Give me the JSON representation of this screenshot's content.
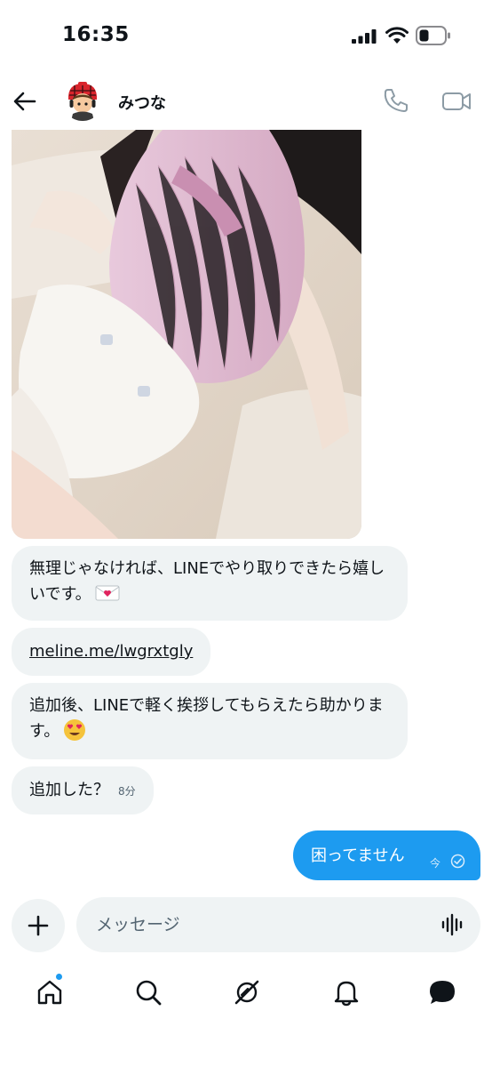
{
  "status_bar": {
    "time": "16:35"
  },
  "header": {
    "contact_name": "みつな"
  },
  "messages": {
    "m1": "無理じゃなければ、LINEでやり取りできたら嬉しいです。",
    "m2_link": "meline.me/lwgrxtgly",
    "m3": "追加後、LINEで軽く挨拶してもらえたら助かります。",
    "m4": "追加した？",
    "m4_time": "8分",
    "out": "困ってません",
    "out_time": "今"
  },
  "compose": {
    "placeholder": "メッセージ"
  },
  "colors": {
    "accent": "#1d9bf0",
    "bubble_in": "#eff3f4",
    "text": "#0f1419",
    "muted": "#536471"
  },
  "icons": [
    "back-arrow-icon",
    "phone-icon",
    "video-icon",
    "plus-icon",
    "voice-icon",
    "home-icon",
    "search-icon",
    "grok-icon",
    "bell-icon",
    "messages-icon"
  ]
}
